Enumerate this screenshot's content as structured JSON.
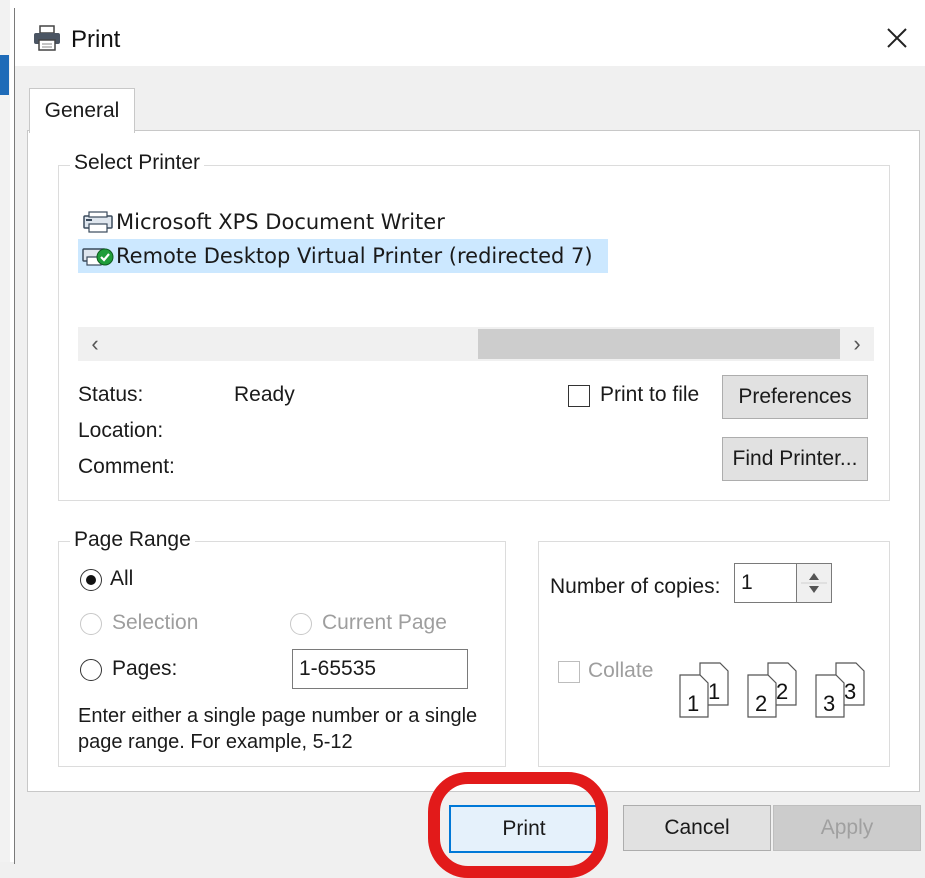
{
  "dialog": {
    "title": "Print",
    "close_icon": "close-icon"
  },
  "tabs": [
    {
      "label": "General"
    }
  ],
  "select_printer": {
    "group_label": "Select Printer",
    "printers": [
      {
        "name": "Microsoft XPS Document Writer",
        "icon": "printer-icon",
        "selected": false
      },
      {
        "name": "Remote Desktop Virtual Printer (redirected 7)",
        "icon": "printer-default-icon",
        "selected": true
      }
    ],
    "status_label": "Status:",
    "status_value": "Ready",
    "location_label": "Location:",
    "location_value": "",
    "comment_label": "Comment:",
    "comment_value": "",
    "print_to_file_label": "Print to file",
    "print_to_file_checked": false,
    "preferences_label": "Preferences",
    "find_printer_label": "Find Printer..."
  },
  "page_range": {
    "group_label": "Page Range",
    "all_label": "All",
    "all_selected": true,
    "selection_label": "Selection",
    "current_page_label": "Current Page",
    "pages_label": "Pages:",
    "pages_value": "1-65535",
    "hint": "Enter either a single page number or a single page range.  For example, 5-12"
  },
  "copies": {
    "label": "Number of copies:",
    "value": "1",
    "collate_label": "Collate",
    "collate_pages": [
      "1",
      "1",
      "2",
      "2",
      "3",
      "3"
    ]
  },
  "footer": {
    "print_label": "Print",
    "cancel_label": "Cancel",
    "apply_label": "Apply"
  },
  "colors": {
    "selection_highlight": "#cce8ff",
    "annotation_ring": "#e21a1a",
    "default_button_border": "#0078d7"
  }
}
